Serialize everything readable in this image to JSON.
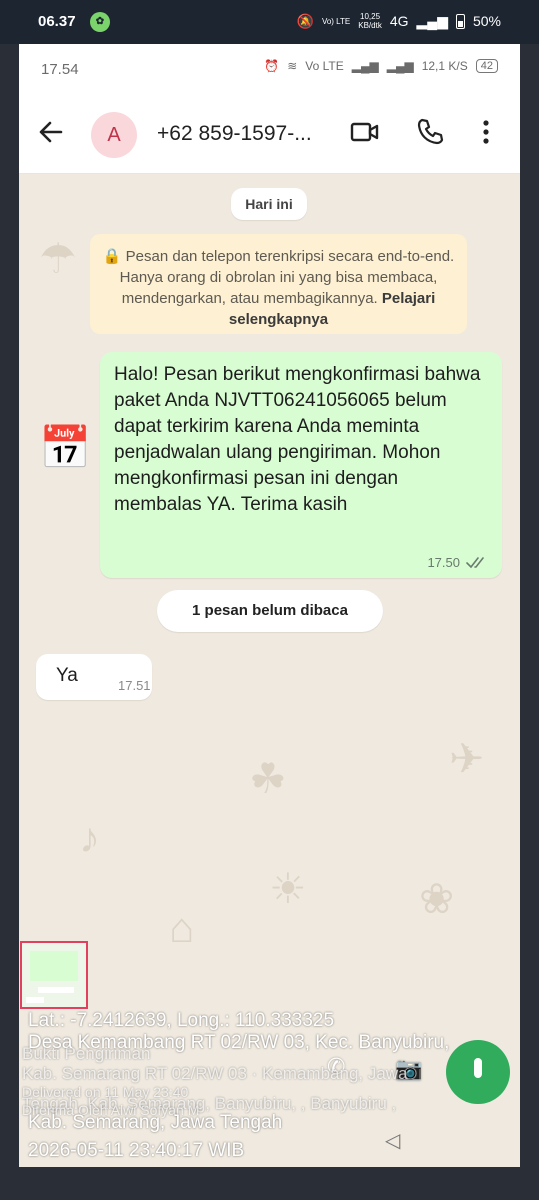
{
  "outer_status": {
    "time": "06.37",
    "speed_value": "10,25",
    "speed_unit": "KB/dtk",
    "volte": "Vo) LTE",
    "network": "4G",
    "battery": "50%"
  },
  "inner_status": {
    "time": "17.54",
    "volte": "Vo LTE",
    "speed_value": "12,1",
    "speed_unit": "K/S",
    "battery": "42"
  },
  "header": {
    "avatar_letter": "A",
    "title": "+62 859-1597-...",
    "icons": [
      "back-arrow-icon",
      "video-call-icon",
      "phone-call-icon",
      "more-vert-icon"
    ]
  },
  "chat": {
    "date_label": "Hari ini",
    "encryption_text": "Pesan dan telepon terenkripsi secara end-to-end. Hanya orang di obrolan ini yang bisa membaca, mendengarkan, atau membagikannya.",
    "encryption_link": "Pelajari selengkapnya",
    "outgoing": {
      "text": "Halo! Pesan berikut mengkonfirmasi bahwa paket Anda NJVTT06241056065 belum dapat terkirim karena Anda meminta penjadwalan ulang pengiriman. Mohon mengkonfirmasi pesan ini dengan membalas YA. Terima kasih",
      "time": "17.50",
      "status_icon": "double-check-icon"
    },
    "unread_label": "1 pesan belum dibaca",
    "incoming": {
      "text": "Ya",
      "time": "17.51"
    }
  },
  "geotag": {
    "coords": "Lat.: -7.2412639, Long.: 110.333325",
    "line1": "Desa Kemambang RT 02/RW 03, Kec. Banyubiru,",
    "line2": "Kab. Semarang, Jawa Tengah",
    "line3": "2026-05-11 23:40:17 WIB",
    "ghost1": "Bukti Pengiriman",
    "ghost2": "Kab. Semarang RT 02/RW 03 · Kemambang, Jawa",
    "ghost3": "Delivered on 11 May 23:40",
    "ghost4": "Tengah, Kab. Semarang, Banyubiru, , Banyubiru ,",
    "ghost5": "Diterima Oleh Alwi Sofyan M"
  }
}
